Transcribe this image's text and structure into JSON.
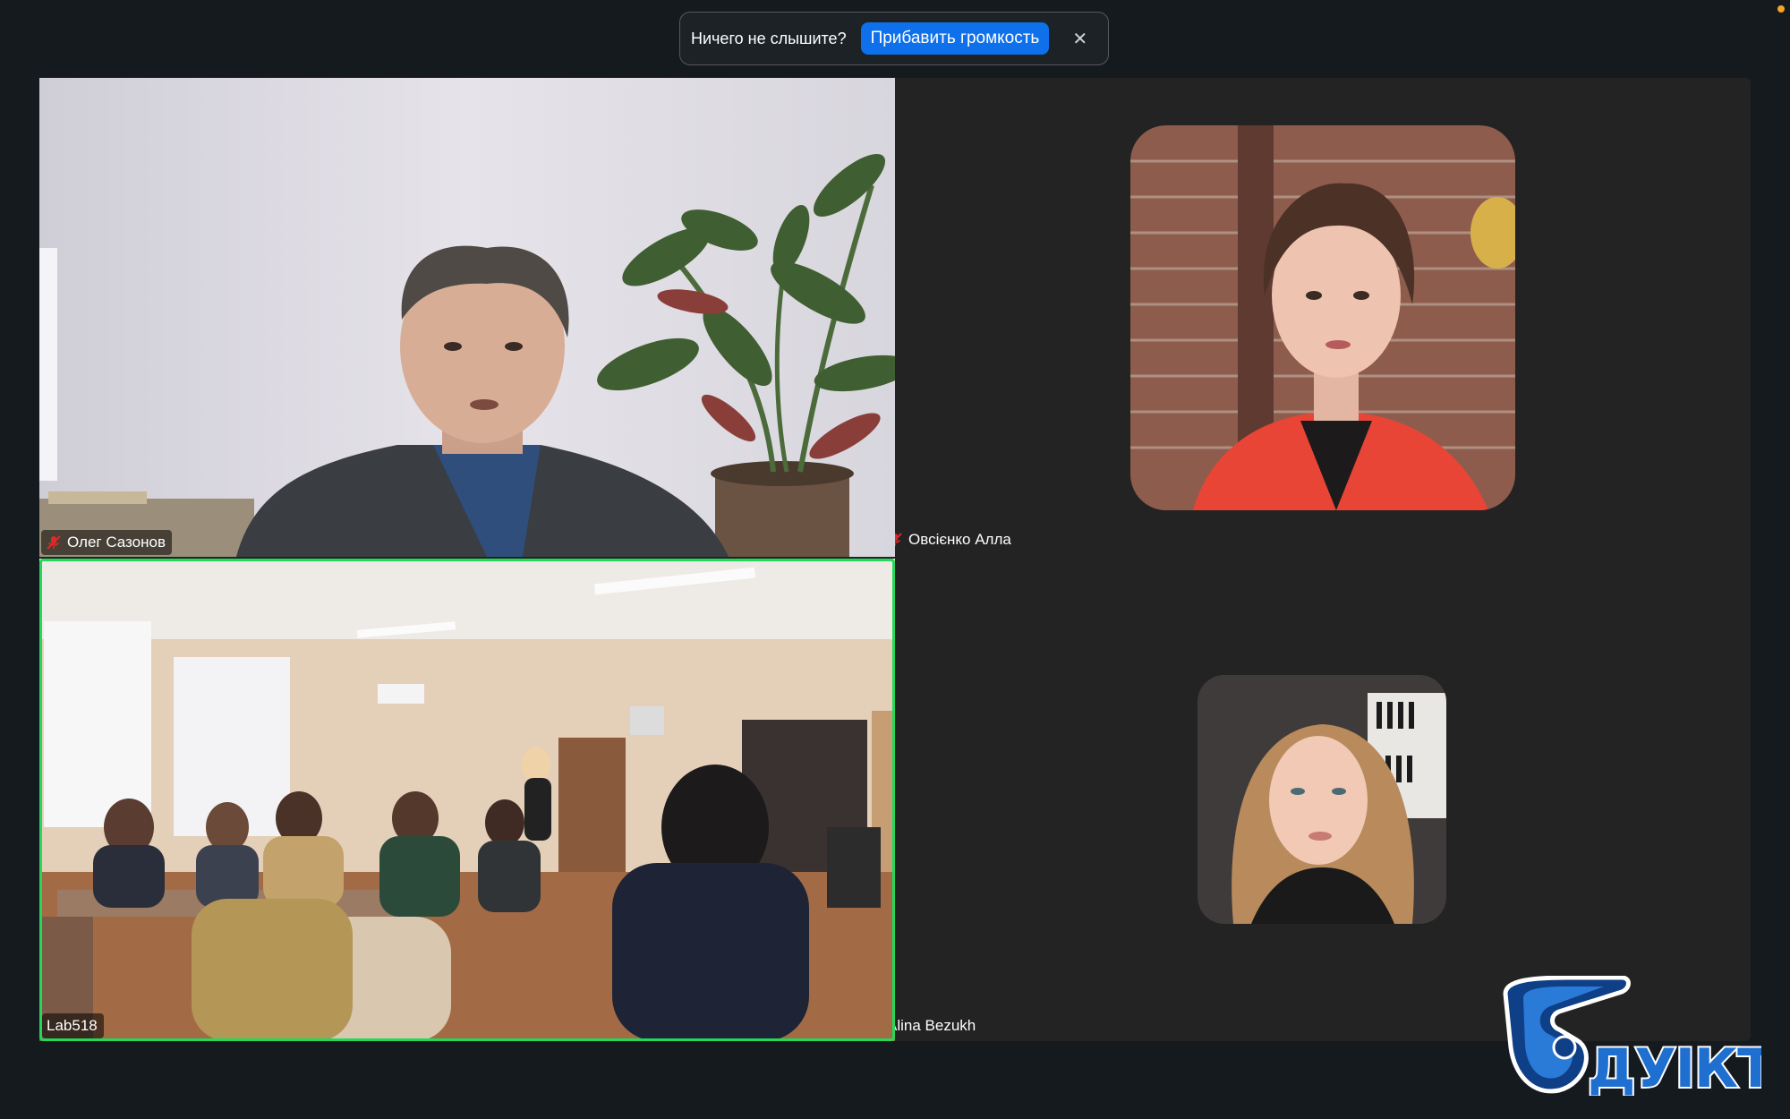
{
  "notification": {
    "message": "Ничего не слышите?",
    "action_label": "Прибавить громкость",
    "close_icon": "close-icon"
  },
  "participants": [
    {
      "name": "Олег Сазонов",
      "muted": true,
      "video": "on"
    },
    {
      "name": "Овсієнко Алла",
      "muted": true,
      "video": "off"
    },
    {
      "name": "Lab518",
      "muted": false,
      "video": "on",
      "active_speaker": true
    },
    {
      "name": "Alina Bezukh",
      "muted": false,
      "video": "off"
    }
  ],
  "logo": {
    "text": "ДУІКТ"
  },
  "colors": {
    "accent": "#0e71eb",
    "active_speaker": "#23d959",
    "muted": "#e02828",
    "background": "#151a1f",
    "tile_background": "#232323"
  }
}
